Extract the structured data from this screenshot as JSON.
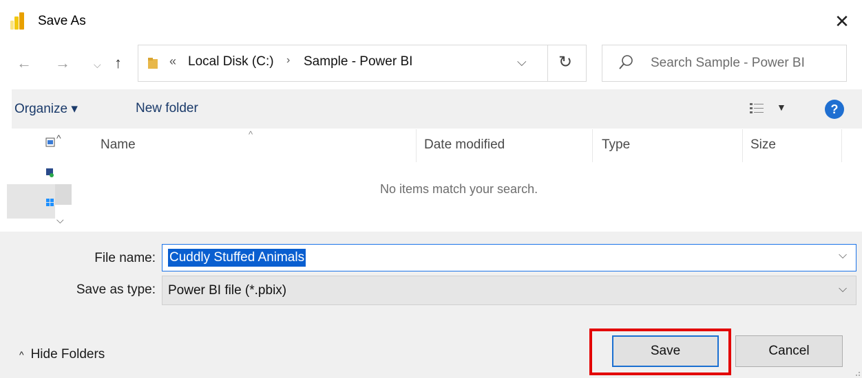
{
  "window": {
    "title": "Save As",
    "close_glyph": "✕"
  },
  "nav": {
    "back_icon": "back-arrow-icon",
    "forward_icon": "forward-arrow-icon",
    "recent_icon": "chevron-down-icon",
    "up_icon": "up-arrow-icon",
    "address": {
      "overflow": "«",
      "segments": [
        "Local Disk (C:)",
        "Sample - Power BI"
      ],
      "separator": "›"
    },
    "search_placeholder": "Search Sample - Power BI"
  },
  "toolbar": {
    "organize_label": "Organize ▾",
    "new_folder_label": "New folder",
    "help_glyph": "?"
  },
  "file_list": {
    "columns": [
      "Name",
      "Date modified",
      "Type",
      "Size"
    ],
    "empty_message": "No items match your search."
  },
  "form": {
    "file_name_label": "File name:",
    "file_name_value": "Cuddly Stuffed Animals",
    "save_type_label": "Save as type:",
    "save_type_value": "Power BI file (*.pbix)"
  },
  "footer": {
    "hide_folders_label": "Hide Folders",
    "save_label": "Save",
    "cancel_label": "Cancel"
  },
  "colors": {
    "accent": "#1a73e8",
    "highlight_box": "#e30000",
    "selection": "#0a5fd0",
    "powerbi_yellow": "#f2c811"
  }
}
